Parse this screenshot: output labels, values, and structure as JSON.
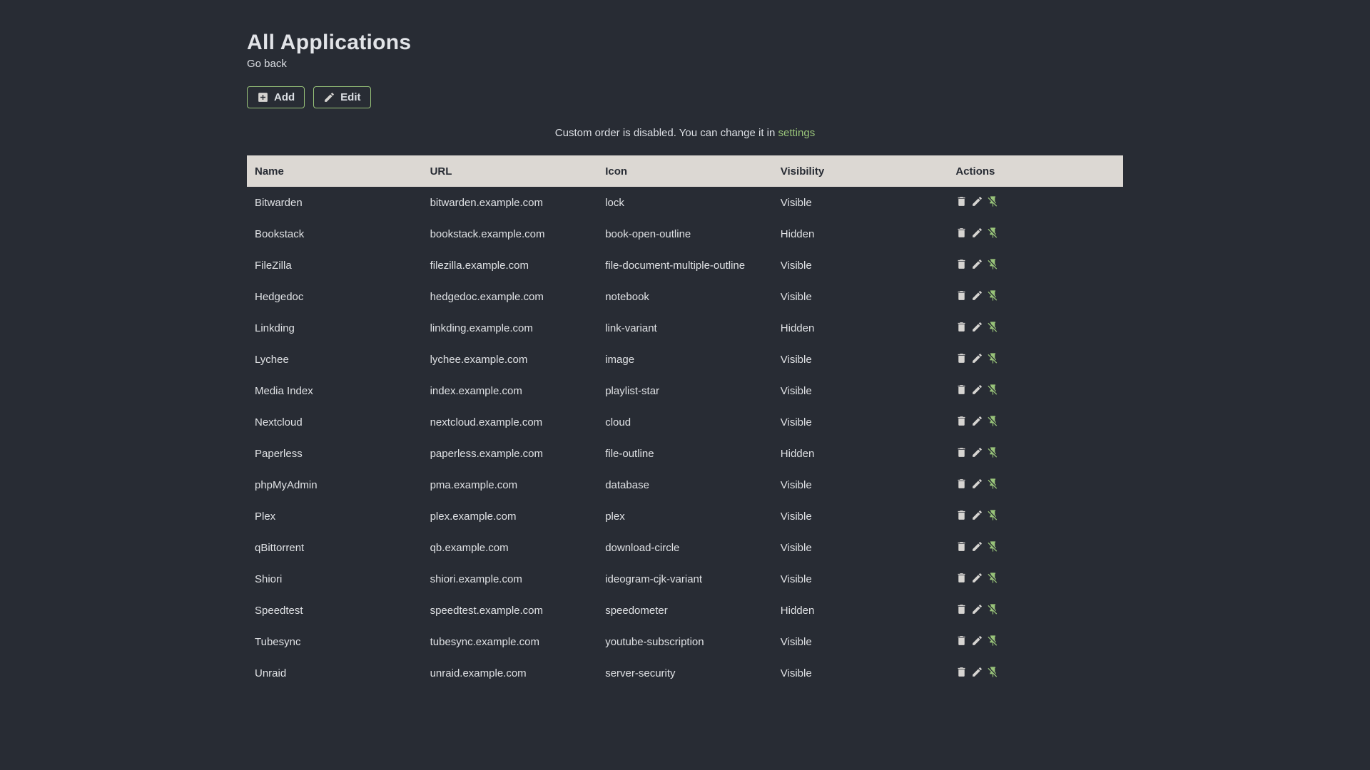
{
  "page": {
    "title": "All Applications",
    "back_link": "Go back"
  },
  "toolbar": {
    "add_label": "Add",
    "add_icon": "plus-box-icon",
    "edit_label": "Edit",
    "edit_icon": "pencil-icon"
  },
  "notice": {
    "text": "Custom order is disabled. You can change it in",
    "link": "settings"
  },
  "table": {
    "headers": [
      "Name",
      "URL",
      "Icon",
      "Visibility",
      "Actions"
    ],
    "action_icons": [
      "trash-icon",
      "pencil-icon",
      "pin-off-icon"
    ],
    "rows": [
      {
        "name": "Bitwarden",
        "url": "bitwarden.example.com",
        "icon": "lock",
        "visibility": "Visible"
      },
      {
        "name": "Bookstack",
        "url": "bookstack.example.com",
        "icon": "book-open-outline",
        "visibility": "Hidden"
      },
      {
        "name": "FileZilla",
        "url": "filezilla.example.com",
        "icon": "file-document-multiple-outline",
        "visibility": "Visible"
      },
      {
        "name": "Hedgedoc",
        "url": "hedgedoc.example.com",
        "icon": "notebook",
        "visibility": "Visible"
      },
      {
        "name": "Linkding",
        "url": "linkding.example.com",
        "icon": "link-variant",
        "visibility": "Hidden"
      },
      {
        "name": "Lychee",
        "url": "lychee.example.com",
        "icon": "image",
        "visibility": "Visible"
      },
      {
        "name": "Media Index",
        "url": "index.example.com",
        "icon": "playlist-star",
        "visibility": "Visible"
      },
      {
        "name": "Nextcloud",
        "url": "nextcloud.example.com",
        "icon": "cloud",
        "visibility": "Visible"
      },
      {
        "name": "Paperless",
        "url": "paperless.example.com",
        "icon": "file-outline",
        "visibility": "Hidden"
      },
      {
        "name": "phpMyAdmin",
        "url": "pma.example.com",
        "icon": "database",
        "visibility": "Visible"
      },
      {
        "name": "Plex",
        "url": "plex.example.com",
        "icon": "plex",
        "visibility": "Visible"
      },
      {
        "name": "qBittorrent",
        "url": "qb.example.com",
        "icon": "download-circle",
        "visibility": "Visible"
      },
      {
        "name": "Shiori",
        "url": "shiori.example.com",
        "icon": "ideogram-cjk-variant",
        "visibility": "Visible"
      },
      {
        "name": "Speedtest",
        "url": "speedtest.example.com",
        "icon": "speedometer",
        "visibility": "Hidden"
      },
      {
        "name": "Tubesync",
        "url": "tubesync.example.com",
        "icon": "youtube-subscription",
        "visibility": "Visible"
      },
      {
        "name": "Unraid",
        "url": "unraid.example.com",
        "icon": "server-security",
        "visibility": "Visible"
      }
    ]
  },
  "colors": {
    "background": "#282c34",
    "text": "#dcdfe4",
    "accent": "#98c379",
    "table_header_bg": "#dcd8d3",
    "table_header_text": "#272b33"
  }
}
